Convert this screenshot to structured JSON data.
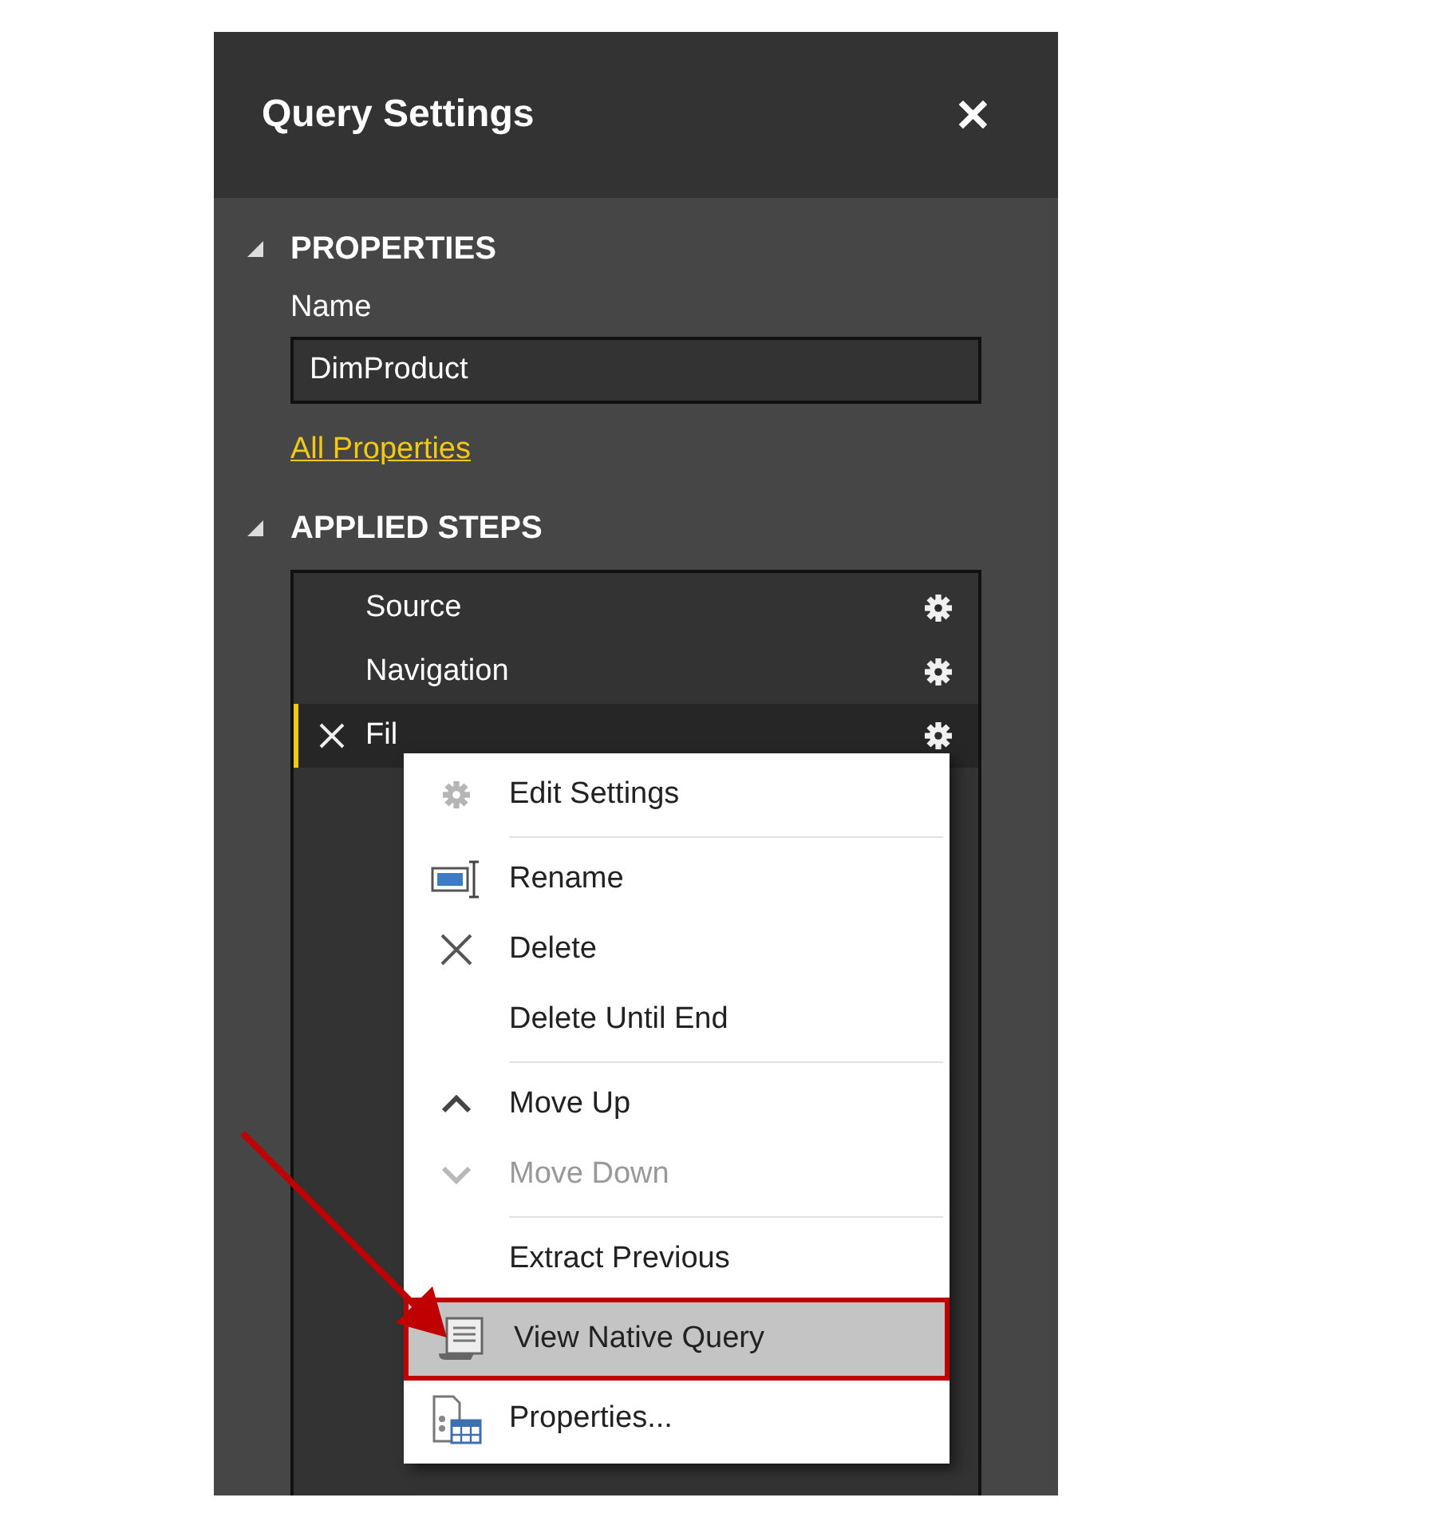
{
  "panel": {
    "title": "Query Settings",
    "close": "✕"
  },
  "properties": {
    "heading": "PROPERTIES",
    "name_label": "Name",
    "name_value": "DimProduct",
    "link": "All Properties",
    "expanded": true
  },
  "applied_steps": {
    "heading": "APPLIED STEPS",
    "expanded": true,
    "steps": [
      {
        "label": "Source",
        "selected": false,
        "settings": true
      },
      {
        "label": "Navigation",
        "selected": false,
        "settings": true
      },
      {
        "label": "Fil",
        "selected": true,
        "settings": true
      }
    ]
  },
  "context_menu": {
    "items": [
      {
        "kind": "gear",
        "label": "Edit Settings",
        "disabled": false,
        "selected": false
      },
      {
        "kind": "separator"
      },
      {
        "kind": "rename",
        "label": "Rename",
        "disabled": false,
        "selected": false
      },
      {
        "kind": "delete",
        "label": "Delete",
        "disabled": false,
        "selected": false
      },
      {
        "kind": "plain",
        "label": "Delete Until End",
        "disabled": false,
        "selected": false
      },
      {
        "kind": "separator"
      },
      {
        "kind": "up",
        "label": "Move Up",
        "disabled": false,
        "selected": false
      },
      {
        "kind": "down",
        "label": "Move Down",
        "disabled": true,
        "selected": false
      },
      {
        "kind": "separator"
      },
      {
        "kind": "plain",
        "label": "Extract Previous",
        "disabled": false,
        "selected": false
      },
      {
        "kind": "query",
        "label": "View Native Query",
        "disabled": false,
        "selected": true
      },
      {
        "kind": "properties",
        "label": "Properties...",
        "disabled": false,
        "selected": false
      }
    ]
  },
  "annotations": [
    {
      "kind": "arrow"
    }
  ]
}
